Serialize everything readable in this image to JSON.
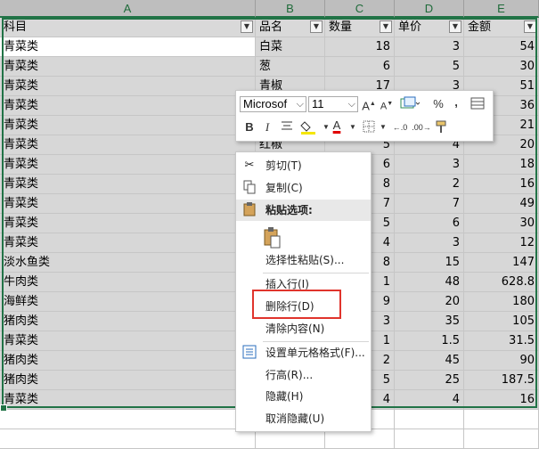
{
  "columns": [
    "A",
    "B",
    "C",
    "D",
    "E"
  ],
  "headers": [
    "科目",
    "品名",
    "数量",
    "单价",
    "金额"
  ],
  "rows": [
    [
      "青菜类",
      "白菜",
      "18",
      "3",
      "54"
    ],
    [
      "青菜类",
      "葱",
      "6",
      "5",
      "30"
    ],
    [
      "青菜类",
      "青椒",
      "17",
      "3",
      "51"
    ],
    [
      "青菜类",
      "",
      "",
      "",
      "36"
    ],
    [
      "青菜类",
      "",
      "",
      "",
      "21"
    ],
    [
      "青菜类",
      "红椒",
      "5",
      "4",
      "20"
    ],
    [
      "青菜类",
      "",
      "6",
      "3",
      "18"
    ],
    [
      "青菜类",
      "",
      "8",
      "2",
      "16"
    ],
    [
      "青菜类",
      "",
      "7",
      "7",
      "49"
    ],
    [
      "青菜类",
      "",
      "5",
      "6",
      "30"
    ],
    [
      "青菜类",
      "",
      "4",
      "3",
      "12"
    ],
    [
      "淡水鱼类",
      "",
      "8",
      "15",
      "147"
    ],
    [
      "牛肉类",
      "",
      "1",
      "48",
      "628.8"
    ],
    [
      "海鲜类",
      "",
      "9",
      "20",
      "180"
    ],
    [
      "猪肉类",
      "",
      "3",
      "35",
      "105"
    ],
    [
      "青菜类",
      "",
      "1",
      "1.5",
      "31.5"
    ],
    [
      "猪肉类",
      "",
      "2",
      "45",
      "90"
    ],
    [
      "猪肉类",
      "",
      "5",
      "25",
      "187.5"
    ],
    [
      "青菜类",
      "",
      "4",
      "4",
      "16"
    ]
  ],
  "mini_toolbar": {
    "font_name": "Microsof",
    "font_size": "11",
    "percent": "%",
    "comma": ",",
    "bold": "B",
    "italic": "I",
    "font_color_letter": "A",
    "accent_font_color": "#e00000",
    "accent_fill_color": "#f5e600"
  },
  "context_menu": {
    "cut": "剪切(T)",
    "copy": "复制(C)",
    "paste_options": "粘贴选项:",
    "paste_special": "选择性粘贴(S)...",
    "insert_row": "插入行(I)",
    "delete_row": "删除行(D)",
    "clear_contents": "清除内容(N)",
    "format_cells": "设置单元格格式(F)...",
    "row_height": "行高(R)...",
    "hide": "隐藏(H)",
    "unhide": "取消隐藏(U)"
  },
  "colors": {
    "selection": "#217346",
    "highlight_box": "#e0342c"
  }
}
